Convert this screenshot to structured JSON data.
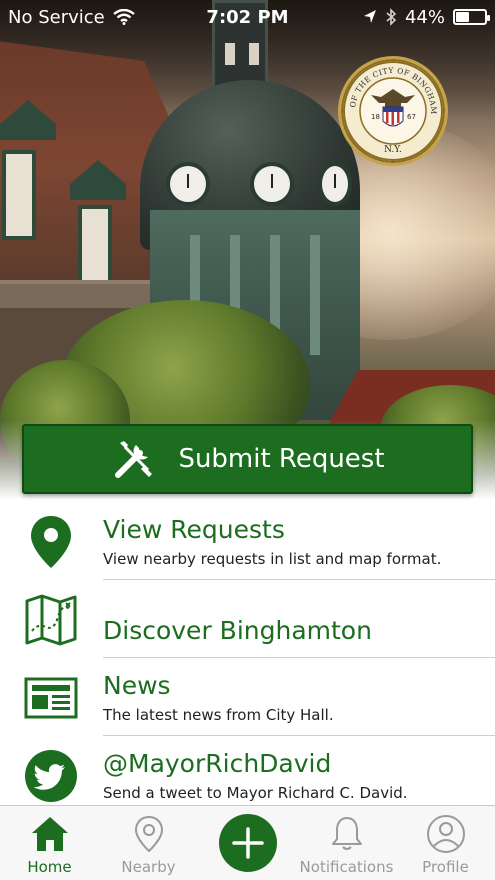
{
  "status_bar": {
    "carrier": "No Service",
    "time": "7:02 PM",
    "battery_percent": "44%",
    "battery_level": 0.44,
    "icons": [
      "wifi-icon",
      "location-arrow-icon",
      "bluetooth-icon",
      "battery-icon"
    ]
  },
  "seal": {
    "text_top": "SEAL OF THE CITY OF BINGHAMTON",
    "text_bottom": "N.Y.",
    "year_left": "18",
    "year_right": "67"
  },
  "submit": {
    "label": "Submit Request",
    "icon": "tools-icon"
  },
  "menu": [
    {
      "icon": "map-pin-icon",
      "title": "View Requests",
      "subtitle": "View nearby requests in list and map format."
    },
    {
      "icon": "folded-map-icon",
      "title": "Discover Binghamton",
      "subtitle": ""
    },
    {
      "icon": "newspaper-icon",
      "title": "News",
      "subtitle": "The latest news from City Hall."
    },
    {
      "icon": "twitter-bird-icon",
      "title": "@MayorRichDavid",
      "subtitle": "Send a tweet to Mayor Richard C. David."
    }
  ],
  "tabs": [
    {
      "icon": "home-icon",
      "label": "Home",
      "active": true
    },
    {
      "icon": "location-pin-outline-icon",
      "label": "Nearby",
      "active": false
    },
    {
      "icon": "plus-icon",
      "label": "",
      "active": false
    },
    {
      "icon": "bell-icon",
      "label": "Notifications",
      "active": false
    },
    {
      "icon": "user-circle-icon",
      "label": "Profile",
      "active": false
    }
  ],
  "colors": {
    "brand_green": "#1c6d1f",
    "inactive_gray": "#9a9a9a"
  }
}
